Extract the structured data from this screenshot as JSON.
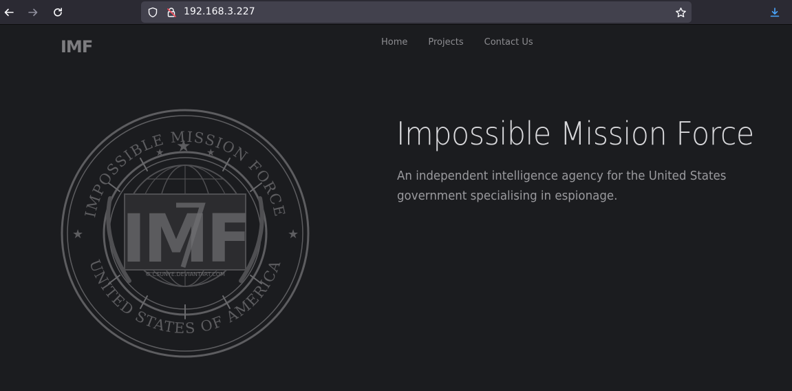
{
  "browser": {
    "url": "192.168.3.227",
    "accent_color": "#4aa7ff"
  },
  "site": {
    "logo_text": "IMF",
    "nav": [
      {
        "label": "Home"
      },
      {
        "label": "Projects"
      },
      {
        "label": "Contact Us"
      }
    ]
  },
  "seal": {
    "top_text": "IMPOSSIBLE MISSION FORCE",
    "bottom_text": "UNITED STATES OF AMERICA",
    "center_text": "IMF",
    "credit": "© CSUNYE.DEVIANTART.COM"
  },
  "hero": {
    "title": "Impossible Mission Force",
    "description": "An independent intelligence agency for the United States government specialising in espionage."
  }
}
